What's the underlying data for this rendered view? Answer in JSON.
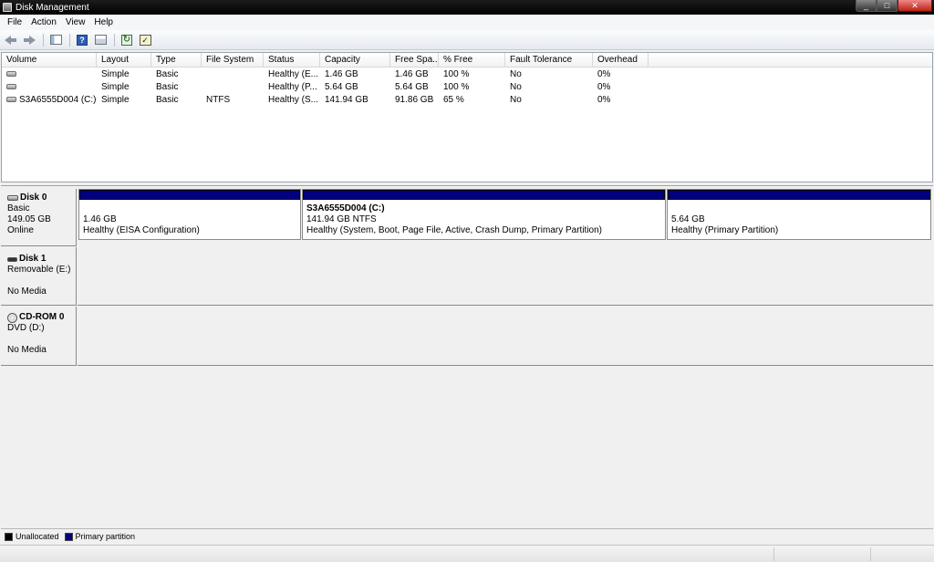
{
  "window": {
    "title": "Disk Management",
    "min_glyph": "_",
    "max_glyph": "□",
    "close_glyph": "✕"
  },
  "menu": [
    {
      "label": "File"
    },
    {
      "label": "Action"
    },
    {
      "label": "View"
    },
    {
      "label": "Help"
    }
  ],
  "toolbar": {
    "buttons": [
      {
        "icon": "back-arrow-icon"
      },
      {
        "icon": "forward-arrow-icon"
      },
      {
        "icon": "show-hide-console-tree-icon"
      },
      {
        "icon": "help-icon",
        "glyph": "?"
      },
      {
        "icon": "properties-icon"
      },
      {
        "icon": "refresh-icon",
        "glyph": "↻"
      },
      {
        "icon": "check-list-icon",
        "glyph": "✓"
      }
    ]
  },
  "volume_list": {
    "columns": [
      "Volume",
      "Layout",
      "Type",
      "File System",
      "Status",
      "Capacity",
      "Free Spa...",
      "% Free",
      "Fault Tolerance",
      "Overhead"
    ],
    "rows": [
      {
        "volume": "",
        "layout": "Simple",
        "type": "Basic",
        "fs": "",
        "status": "Healthy (E...",
        "capacity": "1.46 GB",
        "free": "1.46 GB",
        "pct": "100 %",
        "fault": "No",
        "overhead": "0%"
      },
      {
        "volume": "",
        "layout": "Simple",
        "type": "Basic",
        "fs": "",
        "status": "Healthy (P...",
        "capacity": "5.64 GB",
        "free": "5.64 GB",
        "pct": "100 %",
        "fault": "No",
        "overhead": "0%"
      },
      {
        "volume": "S3A6555D004 (C:)",
        "layout": "Simple",
        "type": "Basic",
        "fs": "NTFS",
        "status": "Healthy (S...",
        "capacity": "141.94 GB",
        "free": "91.86 GB",
        "pct": "65 %",
        "fault": "No",
        "overhead": "0%"
      }
    ]
  },
  "disks": [
    {
      "name": "Disk 0",
      "line1": "Basic",
      "line2": "149.05 GB",
      "line3": "Online",
      "partitions": [
        {
          "name": "",
          "size": "1.46 GB",
          "status": "Healthy (EISA Configuration)"
        },
        {
          "name": "S3A6555D004  (C:)",
          "size": "141.94 GB NTFS",
          "status": "Healthy (System, Boot, Page File, Active, Crash Dump, Primary Partition)"
        },
        {
          "name": "",
          "size": "5.64 GB",
          "status": "Healthy (Primary Partition)"
        }
      ]
    },
    {
      "name": "Disk 1",
      "line1": "Removable (E:)",
      "line2": "",
      "line3": "No Media"
    },
    {
      "name": "CD-ROM 0",
      "line1": "DVD (D:)",
      "line2": "",
      "line3": "No Media"
    }
  ],
  "legend": [
    {
      "label": "Unallocated",
      "color": "#000000"
    },
    {
      "label": "Primary partition",
      "color": "#000080"
    }
  ]
}
